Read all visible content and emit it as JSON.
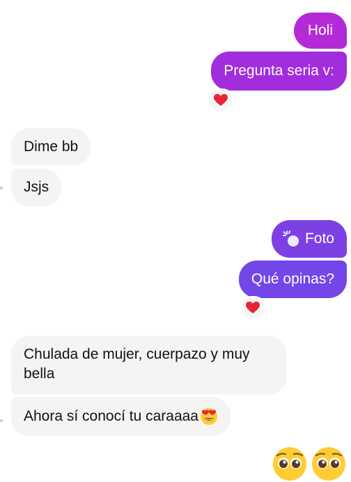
{
  "colors": {
    "outgoing_top": "#b42ad8",
    "outgoing_mid": "#962fe0",
    "outgoing_bottom": "#7346e8",
    "incoming_bg": "#f6f4f3",
    "heart": "#e8243a"
  },
  "messages": {
    "m1": "Holi",
    "m2": "Pregunta seria v:",
    "m3": "Dime bb",
    "m4": "Jsjs",
    "m5": "Foto",
    "m6": "Qué opinas?",
    "m7_line1": "Chulada de mujer, cuerpazo y muy",
    "m7_line2": "bella",
    "m8": "Ahora sí conocí tu caraaaa"
  },
  "icons": {
    "reaction_1": "red-heart-icon",
    "reaction_2": "red-heart-icon",
    "photo_icon": "tap-photo-icon",
    "inline_emoji": "smiling-face-with-heart-eyes-icon",
    "footer_emoji_1": "pleading-face-icon",
    "footer_emoji_2": "pleading-face-icon"
  }
}
